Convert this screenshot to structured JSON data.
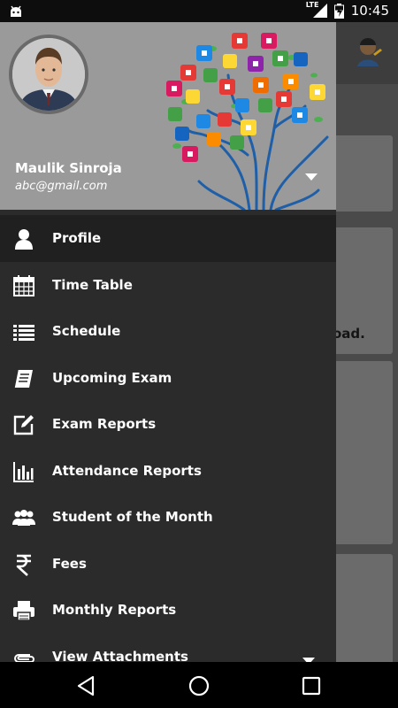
{
  "status_bar": {
    "time": "10:45",
    "network": "LTE",
    "battery_level": 0.6
  },
  "drawer": {
    "user_name": "Maulik Sinroja",
    "user_email": "abc@gmail.com",
    "menu": [
      {
        "label": "Profile",
        "icon": "person-icon",
        "active": true
      },
      {
        "label": "Time Table",
        "icon": "calendar-icon"
      },
      {
        "label": "Schedule",
        "icon": "list-icon"
      },
      {
        "label": "Upcoming Exam",
        "icon": "book-icon"
      },
      {
        "label": "Exam Reports",
        "icon": "edit-icon"
      },
      {
        "label": "Attendance Reports",
        "icon": "bar-chart-icon"
      },
      {
        "label": "Student of the Month",
        "icon": "people-icon"
      },
      {
        "label": "Fees",
        "icon": "rupee-icon"
      },
      {
        "label": "Monthly Reports",
        "icon": "printer-icon"
      },
      {
        "label": "View Attachments",
        "icon": "paperclip-icon"
      }
    ]
  },
  "background": {
    "partial_text": "oad."
  },
  "colors": {
    "drawer_bg": "#2b2b2b",
    "header_bg": "#9a9a9a",
    "active_item_bg": "#202020",
    "text": "#ffffff"
  }
}
